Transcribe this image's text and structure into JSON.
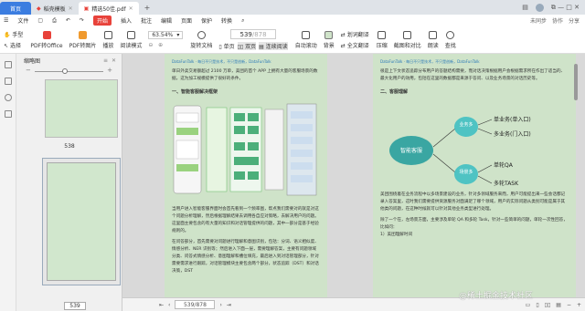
{
  "tabs": {
    "home": "首页",
    "tab1": "稻壳模板",
    "tab2": "精选50佳.pdf",
    "add": "+"
  },
  "titlebar_right": {
    "window_ctrl": "⧉  —  □  ✕"
  },
  "menu": {
    "file": "文件",
    "start": "开始",
    "items": [
      "插入",
      "批注",
      "编辑",
      "页面",
      "保护",
      "转换"
    ],
    "right": [
      "未同步",
      "协作",
      "分享"
    ]
  },
  "ribbon": {
    "hand": "手型",
    "select": "选择",
    "pdf_to_office": "PDF转Office",
    "pdf_to_image": "PDF转图片",
    "play": "播放",
    "read_mode": "阅读模式",
    "zoom": "63.54%",
    "rotate": "旋转文档",
    "page_current": "539",
    "page_total": "/878",
    "single_page": "单页",
    "double_page": "双页",
    "continuous": "连续阅读",
    "auto_scroll": "自动滚动",
    "background": "背景",
    "translate_word": "划词翻译",
    "translate_full": "全文翻译",
    "compress": "压缩",
    "screenshot_compare": "截图和对比",
    "read_aloud": "朗读",
    "find": "查找"
  },
  "thumbnails": {
    "title": "缩略图",
    "page_a": "538",
    "page_b": "539"
  },
  "doc": {
    "runhead_left": "DataFunTalk · 每日不只是技术，不只是创新，DataFunTalk",
    "runhead_right": "DataFunTalk · 每日不只是技术，不只是创新，DataFunTalk",
    "left_para1": "单日外卖交易额超过 2100 万单，美团的首个 APP 上拥有大量的客服场景的数据，这为加工规模提供了很好的条件。",
    "left_heading": "一、智能客服解决框架",
    "left_para2": "当用户进入智能客服界面时会首先看到一个频率图，帮点我们需要对的就是对这个问题分析理解，然后根据理解结果去调用各自应对策略，去解决用户的问题。这里面主要包含的有大量的知识和对话管理提供的问题，其中一部分是基于经验规则的。",
    "left_para3": "在问答部分，首先需要对问题进行理解和意图识别，包括：分词、语义相似度、情感分析、NER 识别等；然后进入下面一层，需要理解答案，主要有问题领域分类、问答式情感分析、意图理解和槽位填充，最后进入到对话管理部分，针对需要需求进行跟踪，对话管理模块主要包含两个部分，状态追踪（DST）和对话决策，DST",
    "right_para1": "很是上下文状态追踪分布用户的答题结构需要，而对话决策根据用户会根据需求所在作出了适当的、最大化用户的效用，包括在这里的数据都是来源于答问、以及业务场景的对话历史等。",
    "right_heading": "二、客服理解",
    "right_para2": "美团围绕着在业务流程中以多场景建设的业务，针对多领域服务来而，用户可能提出来一些会话都记录入答案里，这时我们需要提供资源服务对面满足了哪个领域，用户的实际问题从类别可能是属于其他类的问题，在这种时候就可以针对其他业务类型进行处理。",
    "right_para3": "除了一个在，左场景方面，主要涉及单轮 QA 和多轮 Task，针对一些简单的问题，单轮一次性回答，比如问：",
    "right_list": "1）美团理解时间"
  },
  "mindmap": {
    "root": "智能客服",
    "node_business": "业务多",
    "node_scene": "场景多",
    "leaf1": "单业务(单入口)",
    "leaf2": "多业务(门入口)",
    "leaf3": "单轮QA",
    "leaf4": "多轮TASK"
  },
  "statusbar": {
    "page": "539/878"
  },
  "watermark": "@稀土掘金技术社区",
  "colors": {
    "accent": "#3b7de0",
    "start": "#e8423a",
    "page_bg": "#cfe3c9",
    "mind_root": "#3aa6a2",
    "mind_node": "#4fc3c3"
  }
}
